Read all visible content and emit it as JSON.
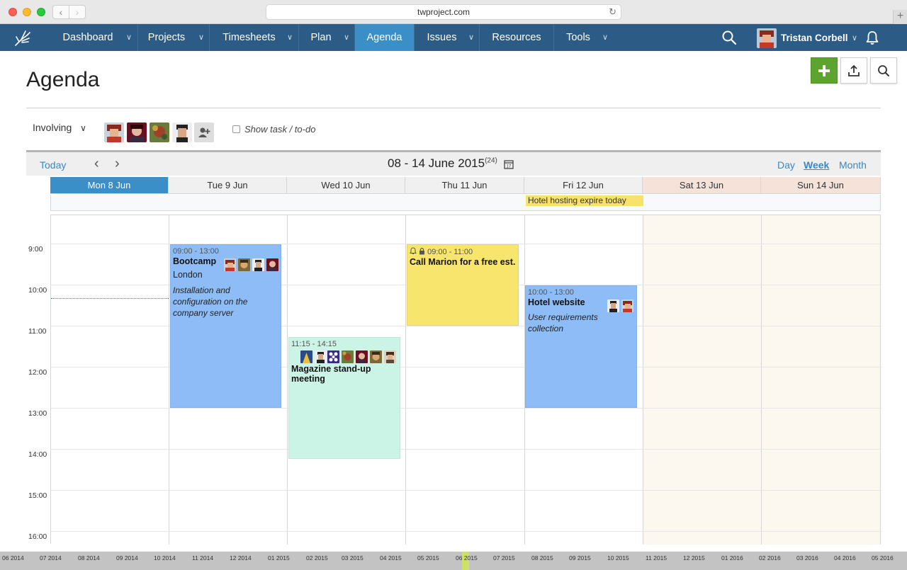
{
  "browser": {
    "url": "twproject.com"
  },
  "nav": {
    "items": [
      "Dashboard",
      "Projects",
      "Timesheets",
      "Plan",
      "Agenda",
      "Issues",
      "Resources",
      "Tools"
    ],
    "user_name": "Tristan Corbell"
  },
  "page": {
    "title": "Agenda"
  },
  "filter": {
    "involving_label": "Involving",
    "show_task_label": "Show task / to-do"
  },
  "toolbar": {
    "today_label": "Today",
    "range_label": "08 - 14 June 2015",
    "week_number": "(24)",
    "views": {
      "day": "Day",
      "week": "Week",
      "month": "Month"
    }
  },
  "days": [
    "Mon 8 Jun",
    "Tue 9 Jun",
    "Wed 10 Jun",
    "Thu 11 Jun",
    "Fri 12 Jun",
    "Sat 13 Jun",
    "Sun 14 Jun"
  ],
  "all_day_event": "Hotel hosting expire today",
  "hours": [
    "9:00",
    "10:00",
    "11:00",
    "12:00",
    "13:00",
    "14:00",
    "15:00",
    "16:00"
  ],
  "events": {
    "bootcamp": {
      "time": "09:00 - 13:00",
      "title": "Bootcamp",
      "location": "London",
      "description": "Installation and configuration on the company server"
    },
    "marion": {
      "time": "09:00 - 11:00",
      "title": "Call Marion for a free est."
    },
    "magazine": {
      "time": "11:15 - 14:15",
      "title": "Magazine stand-up meeting"
    },
    "hotel": {
      "time": "10:00 - 13:00",
      "title": "Hotel website",
      "description": "User requirements collection"
    }
  },
  "timeline": [
    "06 2014",
    "07 2014",
    "08 2014",
    "09 2014",
    "10 2014",
    "11 2014",
    "12 2014",
    "01 2015",
    "02 2015",
    "03 2015",
    "04 2015",
    "05 2015",
    "06 2015",
    "07 2015",
    "08 2015",
    "09 2015",
    "10 2015",
    "11 2015",
    "12 2015",
    "01 2016",
    "02 2016",
    "03 2016",
    "04 2016",
    "05 2016"
  ],
  "colors": {
    "nav": "#2c5b86",
    "nav_active": "#3a8fc9",
    "event_blue": "#8dbcf6",
    "event_yellow": "#f7e56d",
    "event_green": "#cbf4e7",
    "add_button": "#5da42e"
  }
}
